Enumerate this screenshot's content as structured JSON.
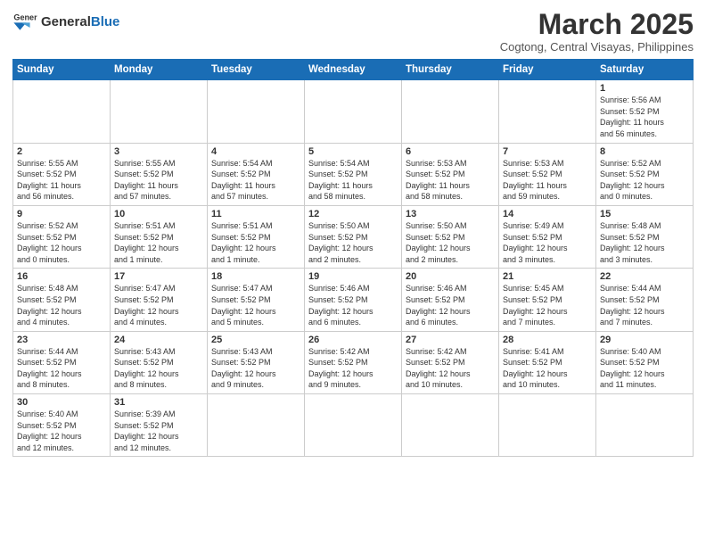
{
  "header": {
    "logo_general": "General",
    "logo_blue": "Blue",
    "month_title": "March 2025",
    "subtitle": "Cogtong, Central Visayas, Philippines"
  },
  "days_of_week": [
    "Sunday",
    "Monday",
    "Tuesday",
    "Wednesday",
    "Thursday",
    "Friday",
    "Saturday"
  ],
  "weeks": [
    [
      {
        "day": "",
        "info": ""
      },
      {
        "day": "",
        "info": ""
      },
      {
        "day": "",
        "info": ""
      },
      {
        "day": "",
        "info": ""
      },
      {
        "day": "",
        "info": ""
      },
      {
        "day": "",
        "info": ""
      },
      {
        "day": "1",
        "info": "Sunrise: 5:56 AM\nSunset: 5:52 PM\nDaylight: 11 hours\nand 56 minutes."
      }
    ],
    [
      {
        "day": "2",
        "info": "Sunrise: 5:55 AM\nSunset: 5:52 PM\nDaylight: 11 hours\nand 56 minutes."
      },
      {
        "day": "3",
        "info": "Sunrise: 5:55 AM\nSunset: 5:52 PM\nDaylight: 11 hours\nand 57 minutes."
      },
      {
        "day": "4",
        "info": "Sunrise: 5:54 AM\nSunset: 5:52 PM\nDaylight: 11 hours\nand 57 minutes."
      },
      {
        "day": "5",
        "info": "Sunrise: 5:54 AM\nSunset: 5:52 PM\nDaylight: 11 hours\nand 58 minutes."
      },
      {
        "day": "6",
        "info": "Sunrise: 5:53 AM\nSunset: 5:52 PM\nDaylight: 11 hours\nand 58 minutes."
      },
      {
        "day": "7",
        "info": "Sunrise: 5:53 AM\nSunset: 5:52 PM\nDaylight: 11 hours\nand 59 minutes."
      },
      {
        "day": "8",
        "info": "Sunrise: 5:52 AM\nSunset: 5:52 PM\nDaylight: 12 hours\nand 0 minutes."
      }
    ],
    [
      {
        "day": "9",
        "info": "Sunrise: 5:52 AM\nSunset: 5:52 PM\nDaylight: 12 hours\nand 0 minutes."
      },
      {
        "day": "10",
        "info": "Sunrise: 5:51 AM\nSunset: 5:52 PM\nDaylight: 12 hours\nand 1 minute."
      },
      {
        "day": "11",
        "info": "Sunrise: 5:51 AM\nSunset: 5:52 PM\nDaylight: 12 hours\nand 1 minute."
      },
      {
        "day": "12",
        "info": "Sunrise: 5:50 AM\nSunset: 5:52 PM\nDaylight: 12 hours\nand 2 minutes."
      },
      {
        "day": "13",
        "info": "Sunrise: 5:50 AM\nSunset: 5:52 PM\nDaylight: 12 hours\nand 2 minutes."
      },
      {
        "day": "14",
        "info": "Sunrise: 5:49 AM\nSunset: 5:52 PM\nDaylight: 12 hours\nand 3 minutes."
      },
      {
        "day": "15",
        "info": "Sunrise: 5:48 AM\nSunset: 5:52 PM\nDaylight: 12 hours\nand 3 minutes."
      }
    ],
    [
      {
        "day": "16",
        "info": "Sunrise: 5:48 AM\nSunset: 5:52 PM\nDaylight: 12 hours\nand 4 minutes."
      },
      {
        "day": "17",
        "info": "Sunrise: 5:47 AM\nSunset: 5:52 PM\nDaylight: 12 hours\nand 4 minutes."
      },
      {
        "day": "18",
        "info": "Sunrise: 5:47 AM\nSunset: 5:52 PM\nDaylight: 12 hours\nand 5 minutes."
      },
      {
        "day": "19",
        "info": "Sunrise: 5:46 AM\nSunset: 5:52 PM\nDaylight: 12 hours\nand 6 minutes."
      },
      {
        "day": "20",
        "info": "Sunrise: 5:46 AM\nSunset: 5:52 PM\nDaylight: 12 hours\nand 6 minutes."
      },
      {
        "day": "21",
        "info": "Sunrise: 5:45 AM\nSunset: 5:52 PM\nDaylight: 12 hours\nand 7 minutes."
      },
      {
        "day": "22",
        "info": "Sunrise: 5:44 AM\nSunset: 5:52 PM\nDaylight: 12 hours\nand 7 minutes."
      }
    ],
    [
      {
        "day": "23",
        "info": "Sunrise: 5:44 AM\nSunset: 5:52 PM\nDaylight: 12 hours\nand 8 minutes."
      },
      {
        "day": "24",
        "info": "Sunrise: 5:43 AM\nSunset: 5:52 PM\nDaylight: 12 hours\nand 8 minutes."
      },
      {
        "day": "25",
        "info": "Sunrise: 5:43 AM\nSunset: 5:52 PM\nDaylight: 12 hours\nand 9 minutes."
      },
      {
        "day": "26",
        "info": "Sunrise: 5:42 AM\nSunset: 5:52 PM\nDaylight: 12 hours\nand 9 minutes."
      },
      {
        "day": "27",
        "info": "Sunrise: 5:42 AM\nSunset: 5:52 PM\nDaylight: 12 hours\nand 10 minutes."
      },
      {
        "day": "28",
        "info": "Sunrise: 5:41 AM\nSunset: 5:52 PM\nDaylight: 12 hours\nand 10 minutes."
      },
      {
        "day": "29",
        "info": "Sunrise: 5:40 AM\nSunset: 5:52 PM\nDaylight: 12 hours\nand 11 minutes."
      }
    ],
    [
      {
        "day": "30",
        "info": "Sunrise: 5:40 AM\nSunset: 5:52 PM\nDaylight: 12 hours\nand 12 minutes."
      },
      {
        "day": "31",
        "info": "Sunrise: 5:39 AM\nSunset: 5:52 PM\nDaylight: 12 hours\nand 12 minutes."
      },
      {
        "day": "",
        "info": ""
      },
      {
        "day": "",
        "info": ""
      },
      {
        "day": "",
        "info": ""
      },
      {
        "day": "",
        "info": ""
      },
      {
        "day": "",
        "info": ""
      }
    ]
  ]
}
